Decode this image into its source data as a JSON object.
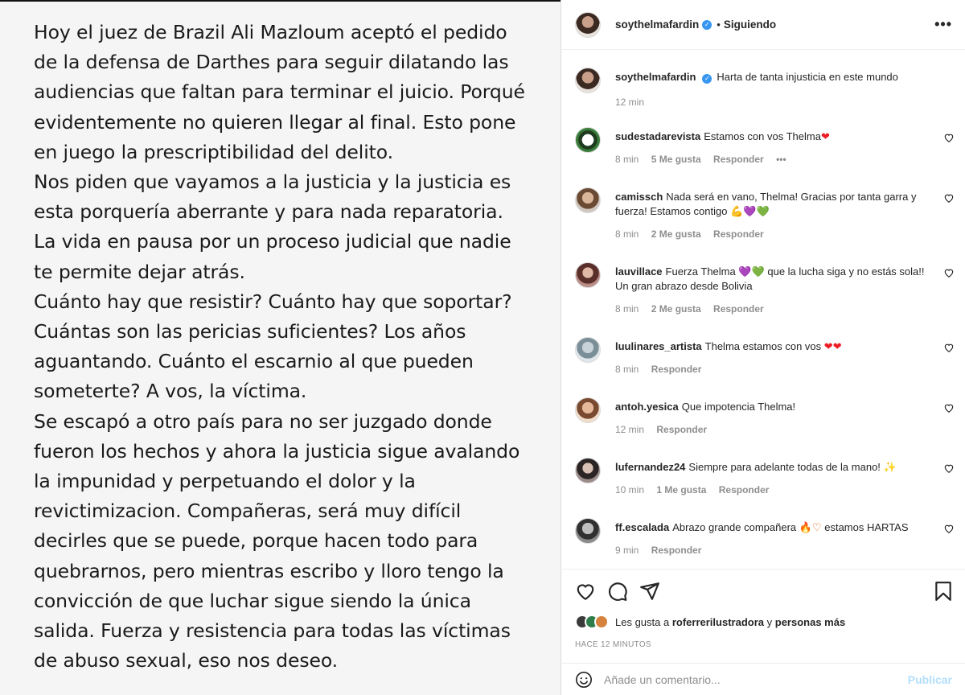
{
  "post": {
    "lines": [
      "Hoy el juez de Brazil Ali Mazloum aceptó el pedido",
      "de la defensa de Darthes para seguir dilatando las",
      "audiencias que faltan para terminar el juicio. Porqué",
      "evidentemente no quieren llegar al final. Esto pone",
      "en juego la prescriptibilidad del delito.",
      "Nos piden que vayamos a la justicia y la justicia es",
      "esta porquería aberrante y para nada reparatoria.",
      "La vida en pausa por un proceso judicial que nadie",
      "te permite dejar atrás.",
      "Cuánto hay que resistir? Cuánto hay que soportar?",
      "Cuántas son las pericias suficientes? Los años",
      "aguantando. Cuánto el escarnio al que pueden",
      "someterte? A vos, la víctima.",
      "Se escapó a otro país para no ser juzgado donde",
      "fueron los hechos y ahora la justicia sigue avalando",
      "la impunidad y perpetuando el dolor y la",
      "revictimizacion. Compañeras, será muy difícil",
      "decirles que se puede, porque hacen todo para",
      "quebrarnos, pero mientras escribo y lloro tengo la",
      "convicción de que luchar sigue siendo la única",
      "salida. Fuerza y resistencia para todas las víctimas",
      "de abuso sexual, eso nos deseo."
    ]
  },
  "header": {
    "username": "soythelmafardin",
    "separator": "•",
    "follow_state": "Siguiendo",
    "more": "•••"
  },
  "caption": {
    "username": "soythelmafardin",
    "text": "Harta de tanta injusticia en este mundo",
    "time": "12 min"
  },
  "comments": [
    {
      "username": "sudestadarevista",
      "text": "Estamos con vos Thelma",
      "emoji": "❤",
      "time": "8 min",
      "likes": "5 Me gusta",
      "reply": "Responder",
      "extra": "•••"
    },
    {
      "username": "camissch",
      "text": "Nada será en vano, Thelma! Gracias por tanta garra y fuerza! Estamos contigo",
      "emoji": "💪💜💚",
      "time": "8 min",
      "likes": "2 Me gusta",
      "reply": "Responder"
    },
    {
      "username": "lauvillace",
      "text_a": "Fuerza Thelma",
      "emoji": "💜💚",
      "text_b": "que la lucha siga y no estás sola!! Un gran abrazo desde Bolivia",
      "time": "8 min",
      "likes": "2 Me gusta",
      "reply": "Responder"
    },
    {
      "username": "luulinares_artista",
      "text": "Thelma estamos con vos",
      "emoji": "❤❤",
      "time": "8 min",
      "reply": "Responder"
    },
    {
      "username": "antoh.yesica",
      "text": "Que impotencia Thelma!",
      "time": "12 min",
      "reply": "Responder"
    },
    {
      "username": "lufernandez24",
      "text": "Siempre para adelante todas de la mano!",
      "emoji": "✨",
      "time": "10 min",
      "likes": "1 Me gusta",
      "reply": "Responder"
    },
    {
      "username": "ff.escalada",
      "text_a": "Abrazo grande compañera",
      "emoji": "🔥♡",
      "text_b": "estamos HARTAS",
      "time": "9 min",
      "reply": "Responder"
    }
  ],
  "likes": {
    "prefix": "Les gusta a",
    "user": "roferrerilustradora",
    "middle": "y",
    "suffix": "personas más"
  },
  "timeago": "HACE 12 MINUTOS",
  "add_comment": {
    "placeholder": "Añade un comentario...",
    "publish": "Publicar"
  },
  "icons": {
    "like": "heart-icon",
    "comment": "comment-icon",
    "share": "share-icon",
    "save": "bookmark-icon",
    "emoji": "emoji-icon",
    "verified": "verified-icon",
    "more": "more-icon"
  },
  "colors": {
    "verified": "#3897f0",
    "publish_disabled": "#b2dffc",
    "meta": "#8e8e8e",
    "heart": "#ed1c24"
  }
}
